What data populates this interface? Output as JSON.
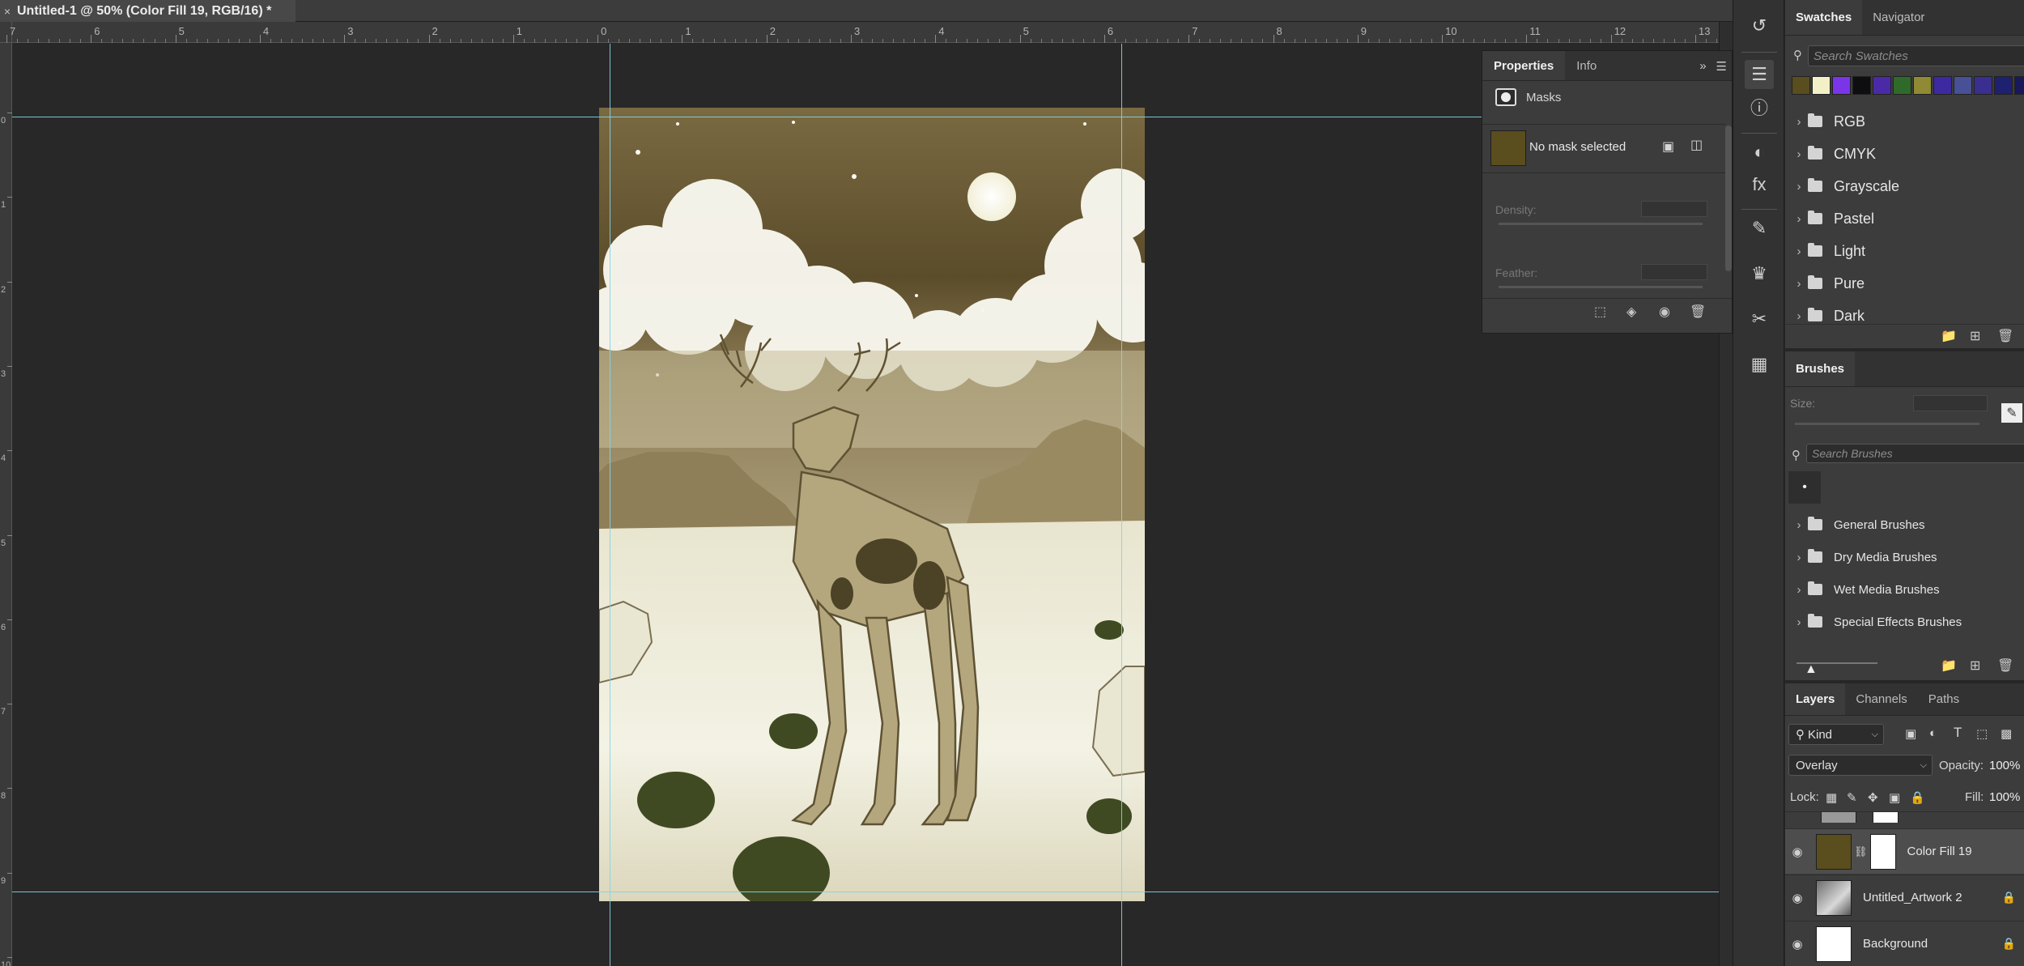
{
  "document": {
    "tab_title": "Untitled-1 @ 50% (Color Fill 19, RGB/16) *",
    "close_glyph": "×"
  },
  "ruler": {
    "h_labels": [
      "7",
      "6",
      "5",
      "4",
      "3",
      "2",
      "1",
      "0",
      "1",
      "2",
      "3",
      "4",
      "5",
      "6",
      "7",
      "8",
      "9",
      "10",
      "11",
      "12",
      "13"
    ],
    "v_labels": [
      "0",
      "1",
      "2",
      "3",
      "4",
      "5",
      "6",
      "7",
      "8",
      "9",
      "10"
    ]
  },
  "properties": {
    "tabs": [
      "Properties",
      "Info"
    ],
    "section": "Masks",
    "mask_status": "No mask selected",
    "density_label": "Density:",
    "feather_label": "Feather:",
    "fill_color": "#5a4d1e"
  },
  "swatches": {
    "tabs": [
      "Swatches",
      "Navigator"
    ],
    "search_placeholder": "Search Swatches",
    "colors": [
      "#5a4d1e",
      "#f3f0c8",
      "#7a35e8",
      "#0e0e12",
      "#4b2aa8",
      "#2f6a2a",
      "#8f8a33",
      "#3d2aa0",
      "#485096",
      "#3a2e90",
      "#1e2070",
      "#18185a"
    ],
    "groups": [
      "RGB",
      "CMYK",
      "Grayscale",
      "Pastel",
      "Light",
      "Pure",
      "Dark"
    ]
  },
  "brushes": {
    "title": "Brushes",
    "size_label": "Size:",
    "search_placeholder": "Search Brushes",
    "groups": [
      "General Brushes",
      "Dry Media Brushes",
      "Wet Media Brushes",
      "Special Effects Brushes"
    ]
  },
  "layers": {
    "tabs": [
      "Layers",
      "Channels",
      "Paths"
    ],
    "kind_label": "Kind",
    "blend_mode": "Overlay",
    "opacity_label": "Opacity:",
    "opacity_value": "100%",
    "lock_label": "Lock:",
    "fill_label": "Fill:",
    "fill_value": "100%",
    "items": [
      {
        "name": "Color Fill 19"
      },
      {
        "name": "Untitled_Artwork 2"
      },
      {
        "name": "Background"
      }
    ]
  }
}
